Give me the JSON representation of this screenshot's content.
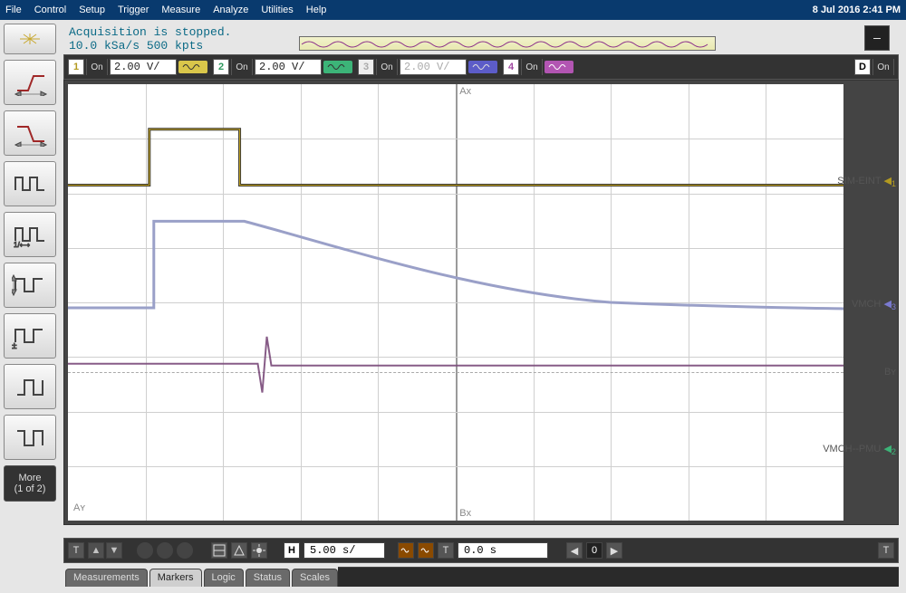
{
  "menu": [
    "File",
    "Control",
    "Setup",
    "Trigger",
    "Measure",
    "Analyze",
    "Utilities",
    "Help"
  ],
  "datetime": "8 Jul 2016  2:41 PM",
  "acquisition": {
    "status": "Acquisition is stopped.",
    "rate": "10.0 kSa/s   500 kpts"
  },
  "channels": [
    {
      "num": "1",
      "on": "On",
      "scale": "2.00 V/",
      "active": true,
      "color": "#d9c64a"
    },
    {
      "num": "2",
      "on": "On",
      "scale": "2.00 V/",
      "active": true,
      "color": "#3cb478"
    },
    {
      "num": "3",
      "on": "On",
      "scale": "2.00 V/",
      "active": false,
      "color": "#5c5cc8"
    },
    {
      "num": "4",
      "on": "On",
      "scale": "",
      "active": true,
      "color": "#b255b2"
    }
  ],
  "digital": {
    "label": "D",
    "on": "On"
  },
  "side_more": {
    "line1": "More",
    "line2": "(1 of 2)"
  },
  "timebase": {
    "scale_label": "H",
    "scale": "5.00 s/",
    "delay": "0.0 s"
  },
  "tabs": [
    "Measurements",
    "Markers",
    "Logic",
    "Status",
    "Scales"
  ],
  "active_tab": 1,
  "wave_labels": {
    "ch1": "SIM-EINT",
    "ch1_mark": "1",
    "ch3": "VMCH",
    "ch3_mark": "3",
    "by": "Bʏ",
    "ch2": "VMCH--PMU",
    "ch2_mark": "2",
    "ay": "Aʏ",
    "ax": "Ax",
    "bx": "Bx"
  },
  "nav": {
    "left": "◀",
    "zero": "0",
    "right": "▶"
  },
  "arrow_up": "▲",
  "arrow_dn": "▼",
  "arrow_l": "◀",
  "arrow_r": "▶",
  "dash": "—"
}
